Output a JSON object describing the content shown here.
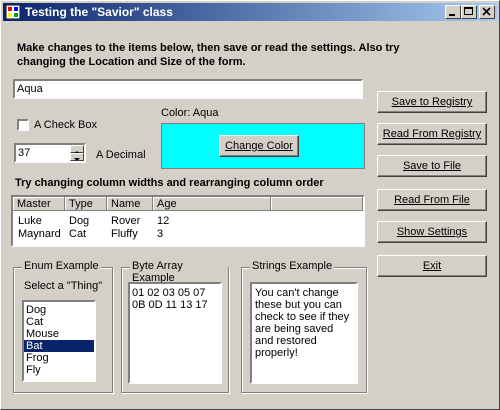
{
  "window": {
    "title": "Testing the \"Savior\" class"
  },
  "instructions": "Make changes to the items below, then save or read the settings. Also try changing the Location and Size of the form.",
  "text_field": {
    "value": "Aqua"
  },
  "color": {
    "label": "Color: Aqua",
    "swatch": "#00ffff",
    "change_button": "Change Color"
  },
  "checkbox": {
    "label": "A Check Box",
    "checked": false
  },
  "decimal": {
    "value": "37",
    "label": "A Decimal"
  },
  "columns_heading": "Try changing column widths and rearranging column order",
  "table": {
    "columns": [
      "Master",
      "Type",
      "Name",
      "Age"
    ],
    "rows": [
      [
        "Luke",
        "Dog",
        "Rover",
        "12"
      ],
      [
        "Maynard",
        "Cat",
        "Fluffy",
        "3"
      ]
    ]
  },
  "buttons": {
    "save_registry": "Save to Registry",
    "read_registry": "Read From Registry",
    "save_file": "Save to File",
    "read_file": "Read From File",
    "show_settings": "Show Settings",
    "exit": "Exit"
  },
  "enum_group": {
    "title": "Enum Example",
    "prompt": "Select a \"Thing\"",
    "items": [
      "Dog",
      "Cat",
      "Mouse",
      "Bat",
      "Frog",
      "Fly"
    ],
    "selected": "Bat"
  },
  "byte_group": {
    "title": "Byte Array Example",
    "text": "01 02 03 05 07 0B 0D 11 13 17"
  },
  "strings_group": {
    "title": "Strings Example",
    "text": "You can't change these but you can check to see if they are being saved and restored properly!"
  },
  "colors": {
    "title_bar": "#0a246a",
    "selection": "#0a246a",
    "face": "#d4d0c8",
    "swatch": "#00ffff"
  }
}
